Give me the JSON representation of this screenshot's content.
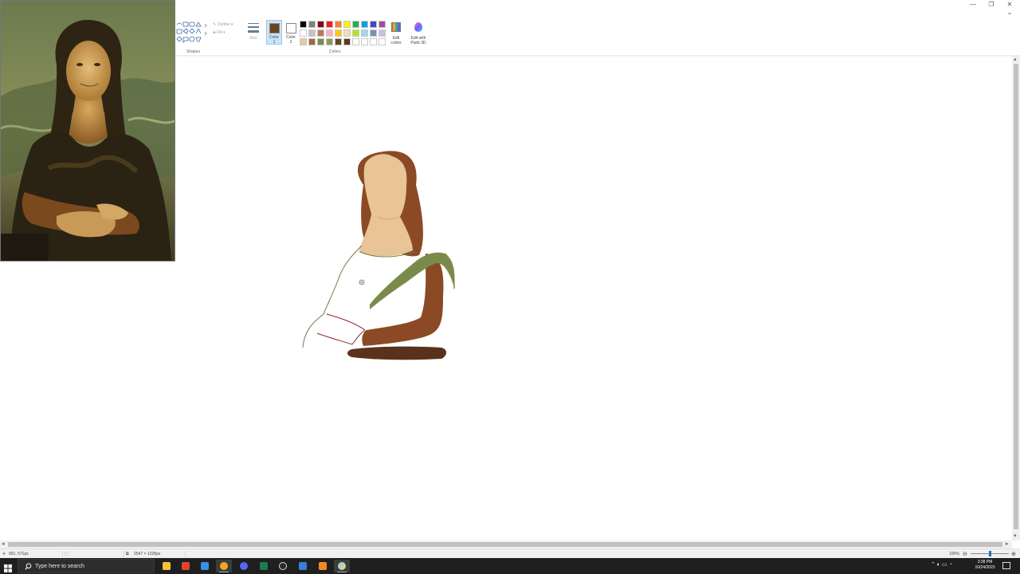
{
  "window": {
    "minimize_glyph": "—",
    "maximize_glyph": "❐",
    "close_glyph": "✕",
    "collapse_ribbon_glyph": "⌄"
  },
  "ribbon": {
    "shapes_group_label": "Shapes",
    "colors_group_label": "Colors",
    "outline_label": "Outline",
    "fill_label": "Fill",
    "size_label": "Size",
    "color1_label_line1": "Color",
    "color1_label_line2": "1",
    "color2_label_line1": "Color",
    "color2_label_line2": "2",
    "edit_colors_line1": "Edit",
    "edit_colors_line2": "colors",
    "paint3d_line1": "Edit with",
    "paint3d_line2": "Paint 3D",
    "color1_value": "#6b4423",
    "color2_value": "#ffffff",
    "palette_row1": [
      "#000000",
      "#7f7f7f",
      "#880015",
      "#ed1c24",
      "#ff7f27",
      "#fff200",
      "#22b14c",
      "#00a2e8",
      "#3f48cc",
      "#a349a4"
    ],
    "palette_row2": [
      "#ffffff",
      "#c3c3c3",
      "#b97a57",
      "#ffaec9",
      "#ffc90e",
      "#efe4b0",
      "#b5e61d",
      "#99d9ea",
      "#7092be",
      "#c8bfe7"
    ],
    "palette_row3": [
      "#e7c9a0",
      "#9c6b3e",
      "#7a8a4a",
      "#8d9a52",
      "#6b4423",
      "#5a3a1e",
      "#ffffff",
      "#ffffff",
      "#ffffff",
      "#ffffff"
    ]
  },
  "reference_image": {
    "subject": "Mona Lisa reference painting"
  },
  "drawing": {
    "skin_color": "#e8c497",
    "hair_color": "#8b4a25",
    "sleeve_color": "#7a8a4a",
    "dark_brown": "#5a321b",
    "outline_green": "#6f7b44",
    "line_red": "#8a2a2a"
  },
  "statusbar": {
    "cursor_position": "901, 571px",
    "image_size": "2547 × 1228px",
    "zoom": "100%",
    "zoom_minus": "⊖",
    "zoom_plus": "⊕"
  },
  "taskbar": {
    "search_placeholder": "Type here to search",
    "apps": [
      "file-explorer",
      "brave-browser",
      "microsoft-store",
      "chrome",
      "discord",
      "excel",
      "obs",
      "photos",
      "adobe",
      "paint"
    ],
    "time": "3:38 PM",
    "date": "10/24/2023"
  }
}
